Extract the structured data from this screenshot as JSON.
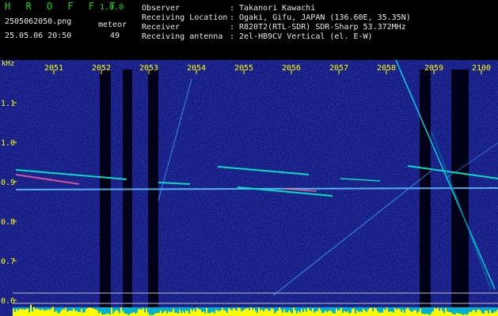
{
  "header": {
    "app_title": "H R O F F T",
    "app_version": "1.0.0",
    "file_name": "2505062050.png",
    "meteor_label": "meteor",
    "timestamp": "25.05.06 20:50",
    "meteor_count": "49",
    "info": [
      {
        "label": "Observer",
        "value": "Takanori Kawachi"
      },
      {
        "label": "Receiving Location",
        "value": "Ogaki, Gifu, JAPAN (136.60E, 35.35N)"
      },
      {
        "label": "Receiver",
        "value": "R820T2(RTL-SDR) SDR-Sharp 53.372MHz"
      },
      {
        "label": "Receiving antenna",
        "value": "2el-HB9CV Vertical (el. E-W)"
      }
    ]
  },
  "chart_data": {
    "type": "heatmap",
    "ylabel": "kHz",
    "y_ticks": [
      "1.1",
      "1.0",
      "0.9",
      "0.8",
      "0.7",
      "0.6"
    ],
    "x_ticks": [
      "2051",
      "2052",
      "2053",
      "2054",
      "2055",
      "2056",
      "2057",
      "2058",
      "2059",
      "2100"
    ],
    "colors": {
      "background": "#0a0a70",
      "text": "#ffff00",
      "tick": "#ffff00",
      "signal": "#00e0c0",
      "echo": "#ff60a0"
    }
  }
}
